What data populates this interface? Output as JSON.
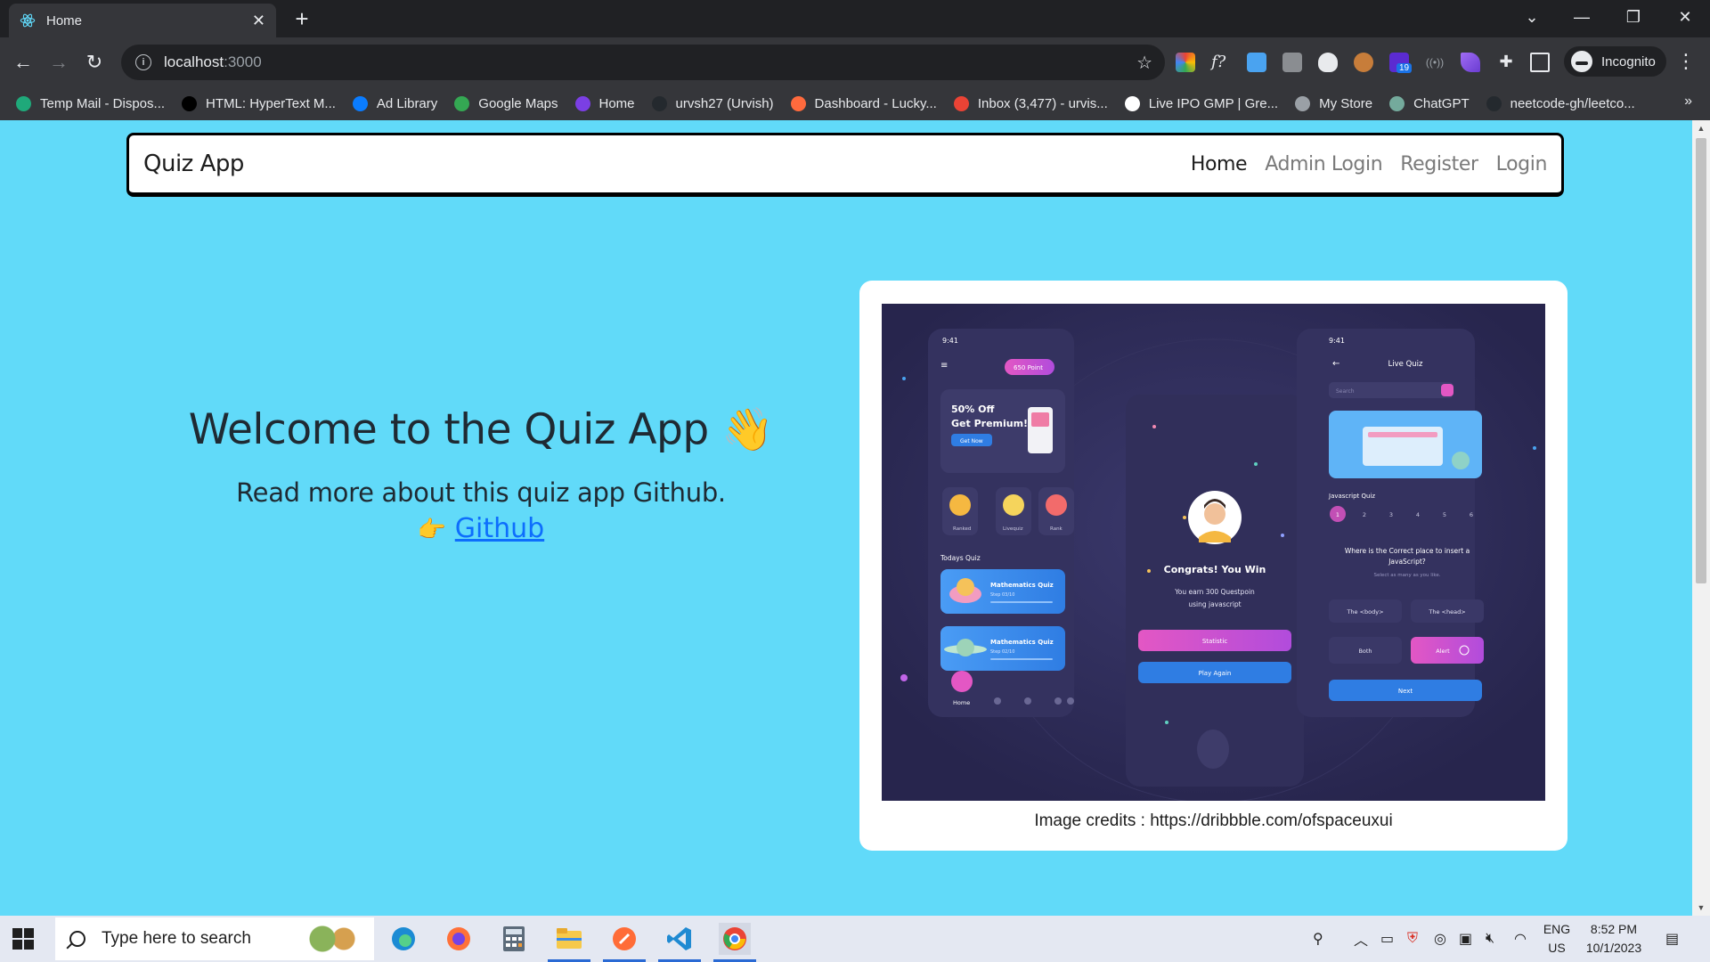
{
  "browser": {
    "tab_title": "Home",
    "url_host": "localhost",
    "url_port": ":3000",
    "profile_label": "Incognito",
    "bookmarks": [
      {
        "label": "Temp Mail - Dispos...",
        "color": "#1fa97a"
      },
      {
        "label": "HTML: HyperText M...",
        "color": "#000000"
      },
      {
        "label": "Ad Library",
        "color": "#0a7cff"
      },
      {
        "label": "Google Maps",
        "color": "#34a853"
      },
      {
        "label": "Home",
        "color": "#7b3fe4"
      },
      {
        "label": "urvsh27 (Urvish)",
        "color": "#24292e"
      },
      {
        "label": "Dashboard - Lucky...",
        "color": "#ff6a3d"
      },
      {
        "label": "Inbox (3,477) - urvis...",
        "color": "#ea4335"
      },
      {
        "label": "Live IPO GMP | Gre...",
        "color": "#ffffff"
      },
      {
        "label": "My Store",
        "color": "#9aa0a6"
      },
      {
        "label": "ChatGPT",
        "color": "#74aa9c"
      },
      {
        "label": "neetcode-gh/leetco...",
        "color": "#24292e"
      }
    ],
    "extension_badge": "19"
  },
  "navbar": {
    "brand": "Quiz App",
    "links": [
      "Home",
      "Admin Login",
      "Register",
      "Login"
    ]
  },
  "hero": {
    "title": "Welcome to the Quiz App",
    "title_emoji": "👋",
    "subtitle": "Read more about this quiz app Github.",
    "link_emoji": "👉",
    "link_text": "Github"
  },
  "card": {
    "credits": "Image credits : https://dribbble.com/ofspaceuxui"
  },
  "mockup": {
    "left_phone": {
      "time": "9:41",
      "points": "650 Point",
      "promo_line1": "50% Off",
      "promo_line2": "Get Premium!",
      "promo_button": "Get Now",
      "categories": [
        "Ranked",
        "Livequiz",
        "Rank"
      ],
      "section_title": "Todays Quiz",
      "quizzes": [
        {
          "title": "Mathematics Quiz",
          "step": "Step 03/10"
        },
        {
          "title": "Mathematics Quiz",
          "step": "Step 02/10"
        }
      ],
      "home_label": "Home"
    },
    "middle_phone": {
      "headline": "Congrats! You Win",
      "message_line1": "You earn 300 Questpoin",
      "message_line2": "using javascript",
      "button_1": "Statistic",
      "button_2": "Play Again"
    },
    "right_phone": {
      "time": "9:41",
      "title": "Live Quiz",
      "search_placeholder": "Search",
      "quiz_label": "Javascript Quiz",
      "numbers": [
        "1",
        "2",
        "3",
        "4",
        "5",
        "6"
      ],
      "question_line1": "Where is the Correct place to insert a",
      "question_line2": "JavaScript?",
      "hint": "Select as many as you like.",
      "options": [
        "The <body>",
        "The <head>",
        "Both",
        "Alert"
      ],
      "next": "Next"
    }
  },
  "taskbar": {
    "search_placeholder": "Type here to search",
    "lang_line1": "ENG",
    "lang_line2": "US",
    "time": "8:52 PM",
    "date": "10/1/2023"
  }
}
